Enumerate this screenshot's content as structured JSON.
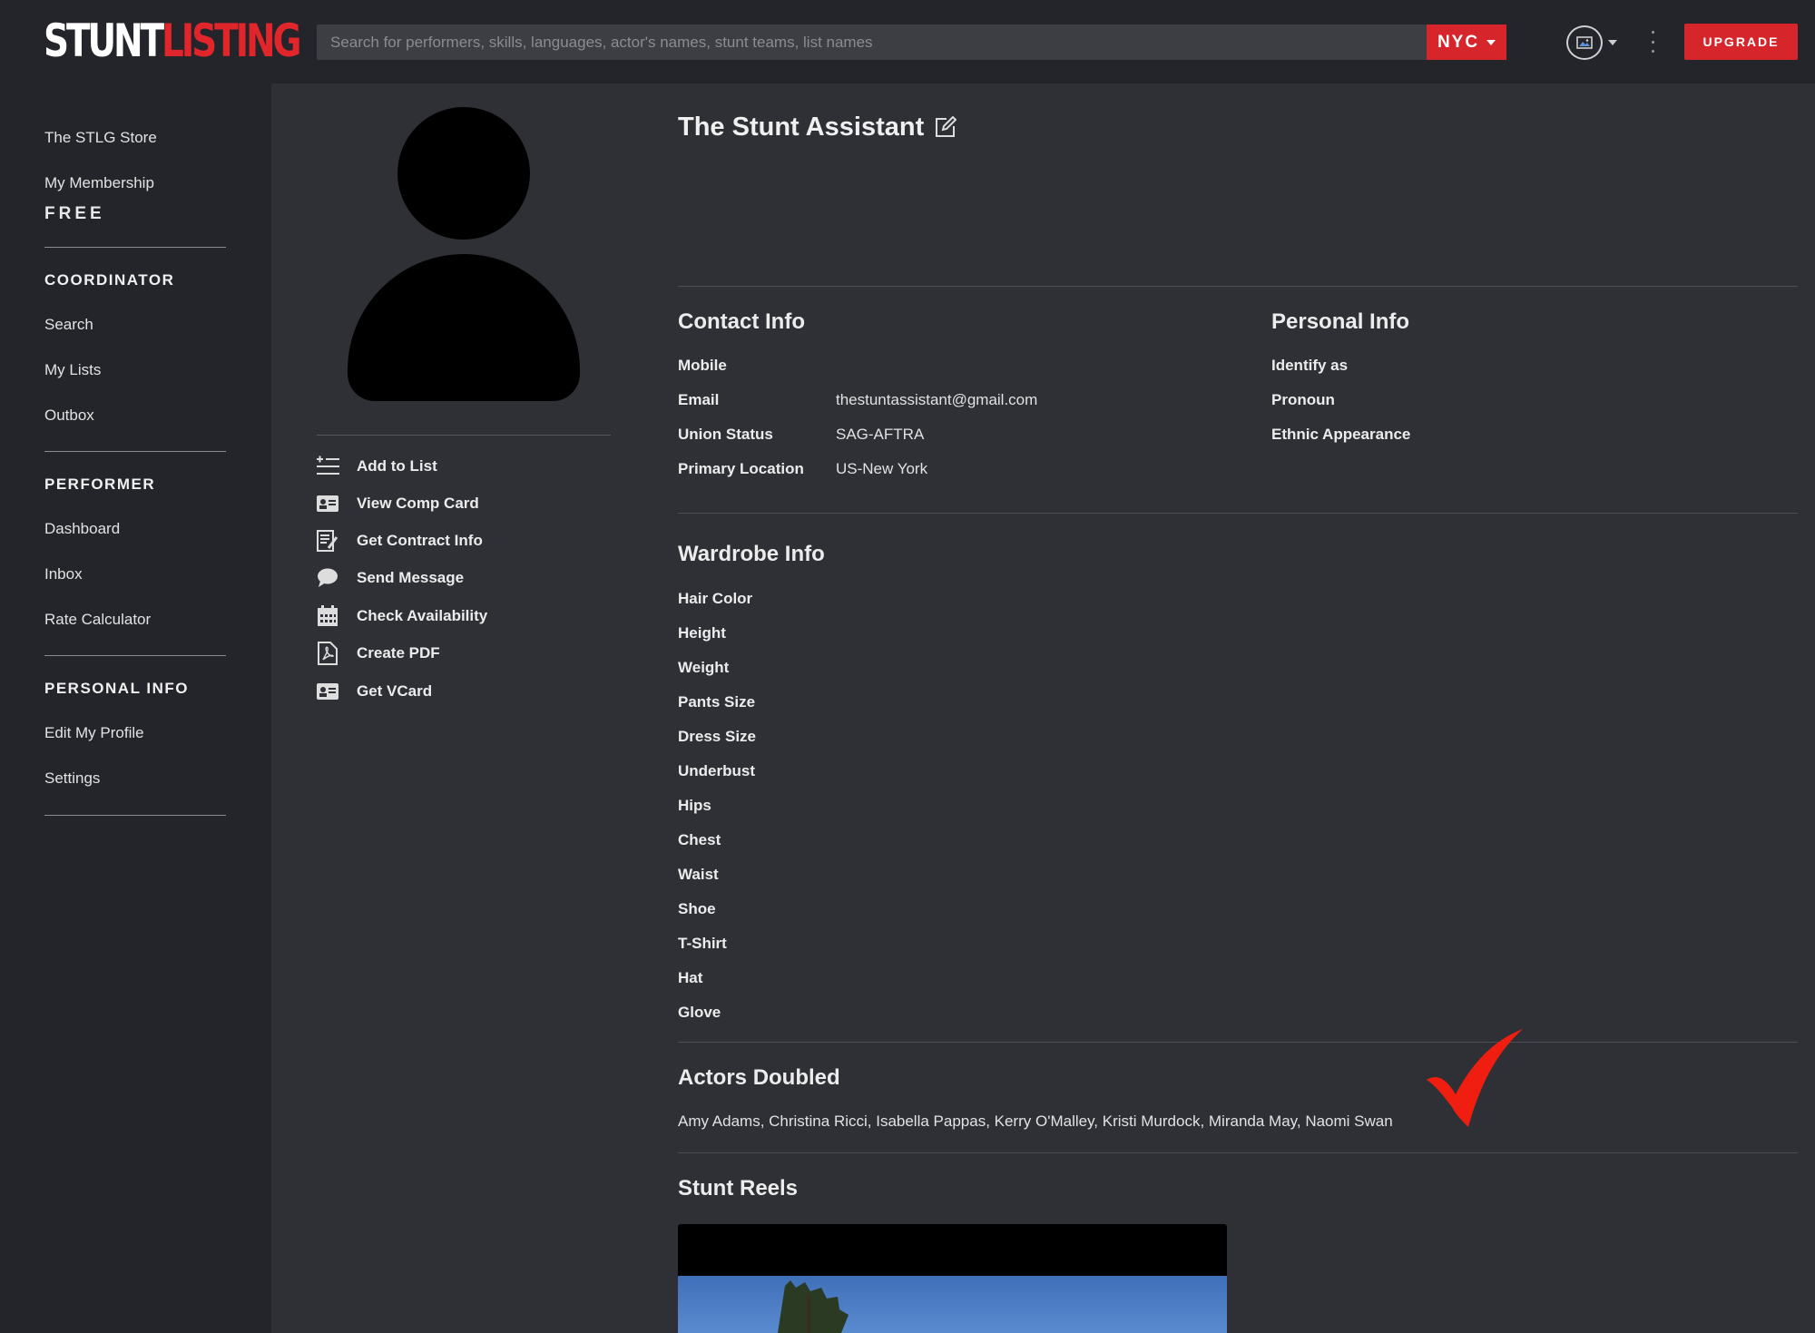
{
  "header": {
    "logo_white": "STUNT",
    "logo_red": "LISTING",
    "search_placeholder": "Search for performers, skills, languages, actor's names, stunt teams, list names",
    "city": "NYC",
    "upgrade_label": "UPGRADE"
  },
  "sidebar": {
    "store": "The STLG Store",
    "membership": "My Membership",
    "membership_tier": "FREE",
    "coordinator_head": "COORDINATOR",
    "coordinator_items": [
      "Search",
      "My Lists",
      "Outbox"
    ],
    "performer_head": "PERFORMER",
    "performer_items": [
      "Dashboard",
      "Inbox",
      "Rate Calculator"
    ],
    "personal_head": "PERSONAL INFO",
    "personal_items": [
      "Edit My Profile",
      "Settings"
    ]
  },
  "actions": [
    {
      "label": "Add to List",
      "icon": "add-list-icon"
    },
    {
      "label": "View Comp Card",
      "icon": "id-card-icon"
    },
    {
      "label": "Get Contract Info",
      "icon": "contract-icon"
    },
    {
      "label": "Send Message",
      "icon": "chat-bubble-icon"
    },
    {
      "label": "Check Availability",
      "icon": "calendar-icon"
    },
    {
      "label": "Create PDF",
      "icon": "pdf-icon"
    },
    {
      "label": "Get VCard",
      "icon": "vcard-icon"
    }
  ],
  "profile": {
    "name": "The Stunt Assistant",
    "contact_head": "Contact Info",
    "contact": [
      {
        "label": "Mobile",
        "value": ""
      },
      {
        "label": "Email",
        "value": "thestuntassistant@gmail.com"
      },
      {
        "label": "Union Status",
        "value": "SAG-AFTRA"
      },
      {
        "label": "Primary Location",
        "value": "US-New York"
      }
    ],
    "personal_head": "Personal Info",
    "personal": [
      {
        "label": "Identify as"
      },
      {
        "label": "Pronoun"
      },
      {
        "label": "Ethnic Appearance"
      }
    ],
    "wardrobe_head": "Wardrobe Info",
    "wardrobe": [
      "Hair Color",
      "Height",
      "Weight",
      "Pants Size",
      "Dress Size",
      "Underbust",
      "Hips",
      "Chest",
      "Waist",
      "Shoe",
      "T-Shirt",
      "Hat",
      "Glove"
    ],
    "actors_head": "Actors Doubled",
    "actors": "Amy Adams, Christina Ricci, Isabella Pappas, Kerry O'Malley, Kristi Murdock, Miranda May, Naomi Swan",
    "reels_head": "Stunt Reels"
  },
  "colors": {
    "accent": "#d7262b",
    "background": "#2e3035",
    "sidebar": "#23252a"
  }
}
